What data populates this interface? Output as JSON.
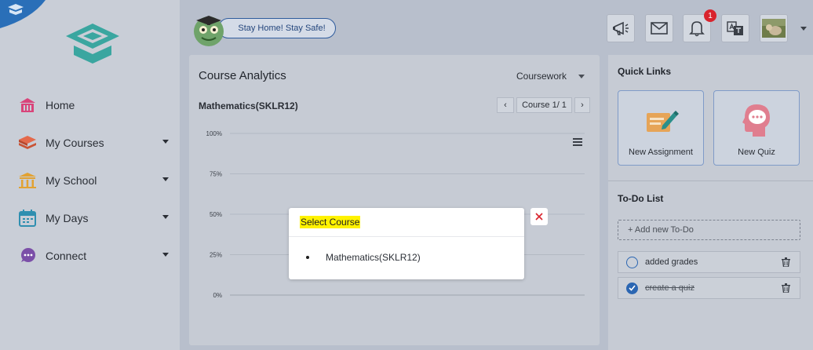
{
  "header": {
    "banner_label": "Stay Home! Stay Safe!",
    "notifications_count": "1"
  },
  "sidebar": {
    "items": [
      {
        "label": "Home",
        "icon": "home-icon"
      },
      {
        "label": "My Courses",
        "icon": "books-icon"
      },
      {
        "label": "My School",
        "icon": "school-icon"
      },
      {
        "label": "My Days",
        "icon": "calendar-icon"
      },
      {
        "label": "Connect",
        "icon": "chat-icon"
      }
    ]
  },
  "analytics": {
    "title": "Course Analytics",
    "dropdown_value": "Coursework",
    "subject": "Mathematics(SKLR12)",
    "pager_label": "Course 1/ 1"
  },
  "chart_data": {
    "type": "bar",
    "categories": [],
    "series": [],
    "y_tick_labels": [
      "100%",
      "75%",
      "50%",
      "25%",
      "0%"
    ],
    "ylim": [
      0,
      100
    ],
    "grid": true
  },
  "quick_links": {
    "title": "Quick Links",
    "items": [
      {
        "label": "New Assignment",
        "icon": "assignment-pen-icon"
      },
      {
        "label": "New Quiz",
        "icon": "quiz-head-icon"
      }
    ]
  },
  "todo": {
    "title": "To-Do List",
    "add_label": "+ Add new To-Do",
    "items": [
      {
        "label": "added grades",
        "done": false
      },
      {
        "label": "create a quiz",
        "done": true
      }
    ]
  },
  "modal": {
    "title": "Select Course",
    "options": [
      "Mathematics(SKLR12)"
    ]
  },
  "colors": {
    "accent_blue": "#2b66b2",
    "badge_red": "#d9232d",
    "highlight_yellow": "#fff200"
  }
}
